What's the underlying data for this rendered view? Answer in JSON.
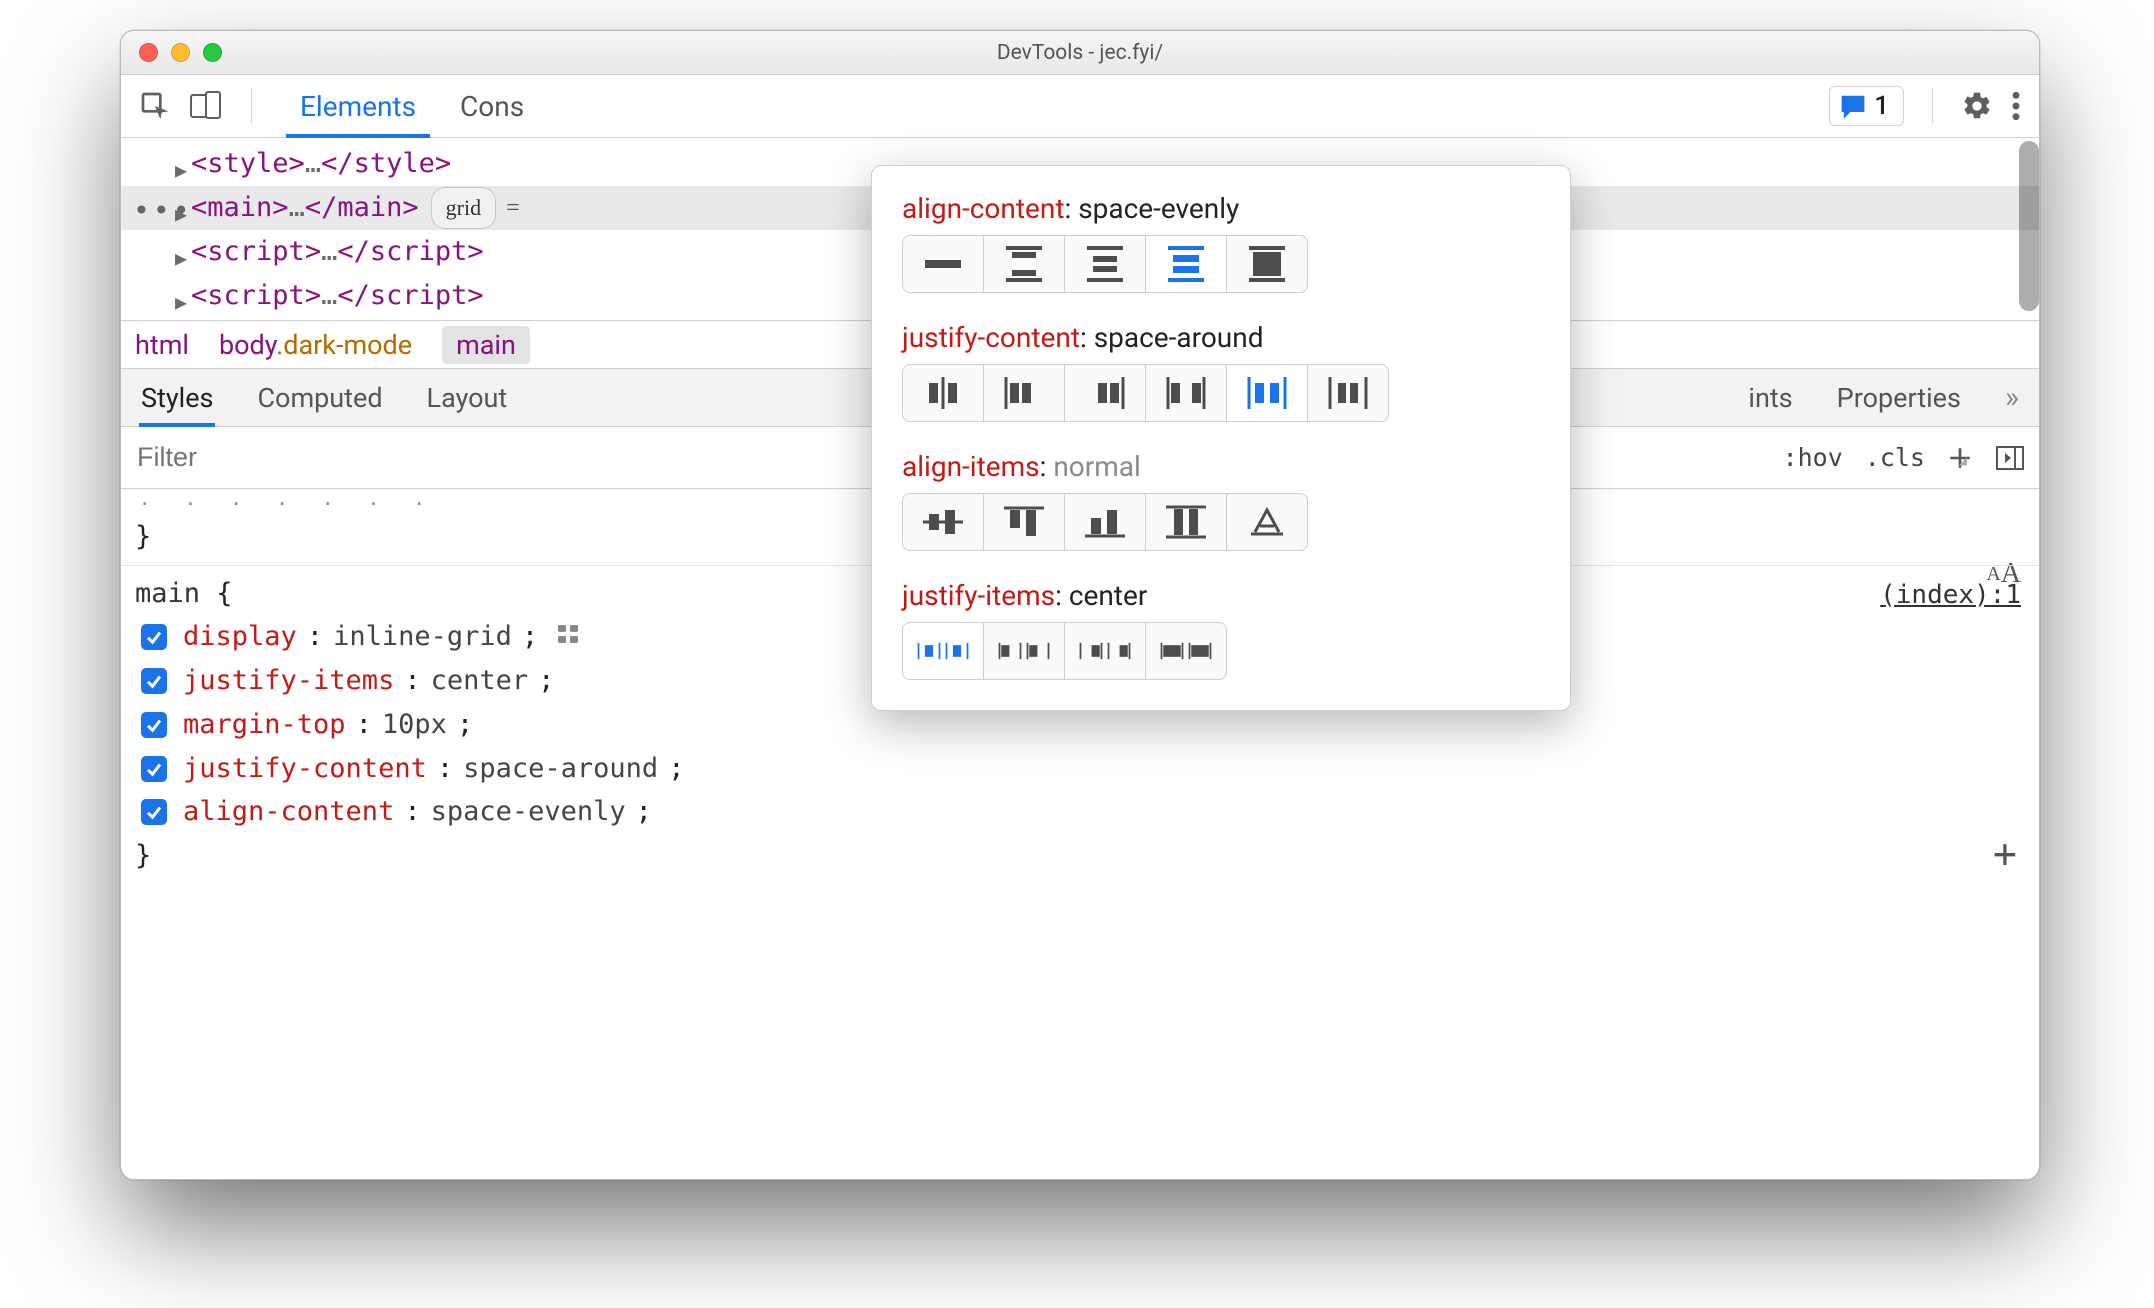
{
  "window": {
    "title": "DevTools - jec.fyi/"
  },
  "tabstrip": {
    "tabs": [
      "Elements",
      "Console"
    ],
    "active": 0,
    "issues_count": "1"
  },
  "dom": {
    "rows": [
      {
        "tag": "style",
        "selected": false,
        "chip": null
      },
      {
        "tag": "main",
        "selected": true,
        "chip": "grid"
      },
      {
        "tag": "script",
        "selected": false,
        "chip": null
      },
      {
        "tag": "script",
        "selected": false,
        "chip": null
      }
    ]
  },
  "breadcrumb": {
    "items": [
      {
        "tag": "html",
        "cls": null
      },
      {
        "tag": "body",
        "cls": ".dark-mode"
      },
      {
        "tag": "main",
        "cls": null
      }
    ],
    "active": 2
  },
  "sidebar_tabs": {
    "tabs": [
      "Styles",
      "Computed",
      "Layout",
      "ints",
      "Properties"
    ],
    "active": 0,
    "overflow": "»"
  },
  "styles_toolbar": {
    "filter_placeholder": "Filter",
    "hov": ":hov",
    "cls": ".cls"
  },
  "rules": {
    "prev_close": "}",
    "selector": "main",
    "source": "(index):1",
    "decls": [
      {
        "prop": "display",
        "val": "inline-grid",
        "grid_icon": true
      },
      {
        "prop": "justify-items",
        "val": "center",
        "grid_icon": false
      },
      {
        "prop": "margin-top",
        "val": "10px",
        "grid_icon": false
      },
      {
        "prop": "justify-content",
        "val": "space-around",
        "grid_icon": false
      },
      {
        "prop": "align-content",
        "val": "space-evenly",
        "grid_icon": false
      }
    ]
  },
  "popover": {
    "groups": [
      {
        "prop": "align-content",
        "val": "space-evenly",
        "muted": false,
        "options": 5,
        "selected": 3
      },
      {
        "prop": "justify-content",
        "val": "space-around",
        "muted": false,
        "options": 6,
        "selected": 4
      },
      {
        "prop": "align-items",
        "val": "normal",
        "muted": true,
        "options": 5,
        "selected": -1
      },
      {
        "prop": "justify-items",
        "val": "center",
        "muted": false,
        "options": 4,
        "selected": 0
      }
    ]
  }
}
